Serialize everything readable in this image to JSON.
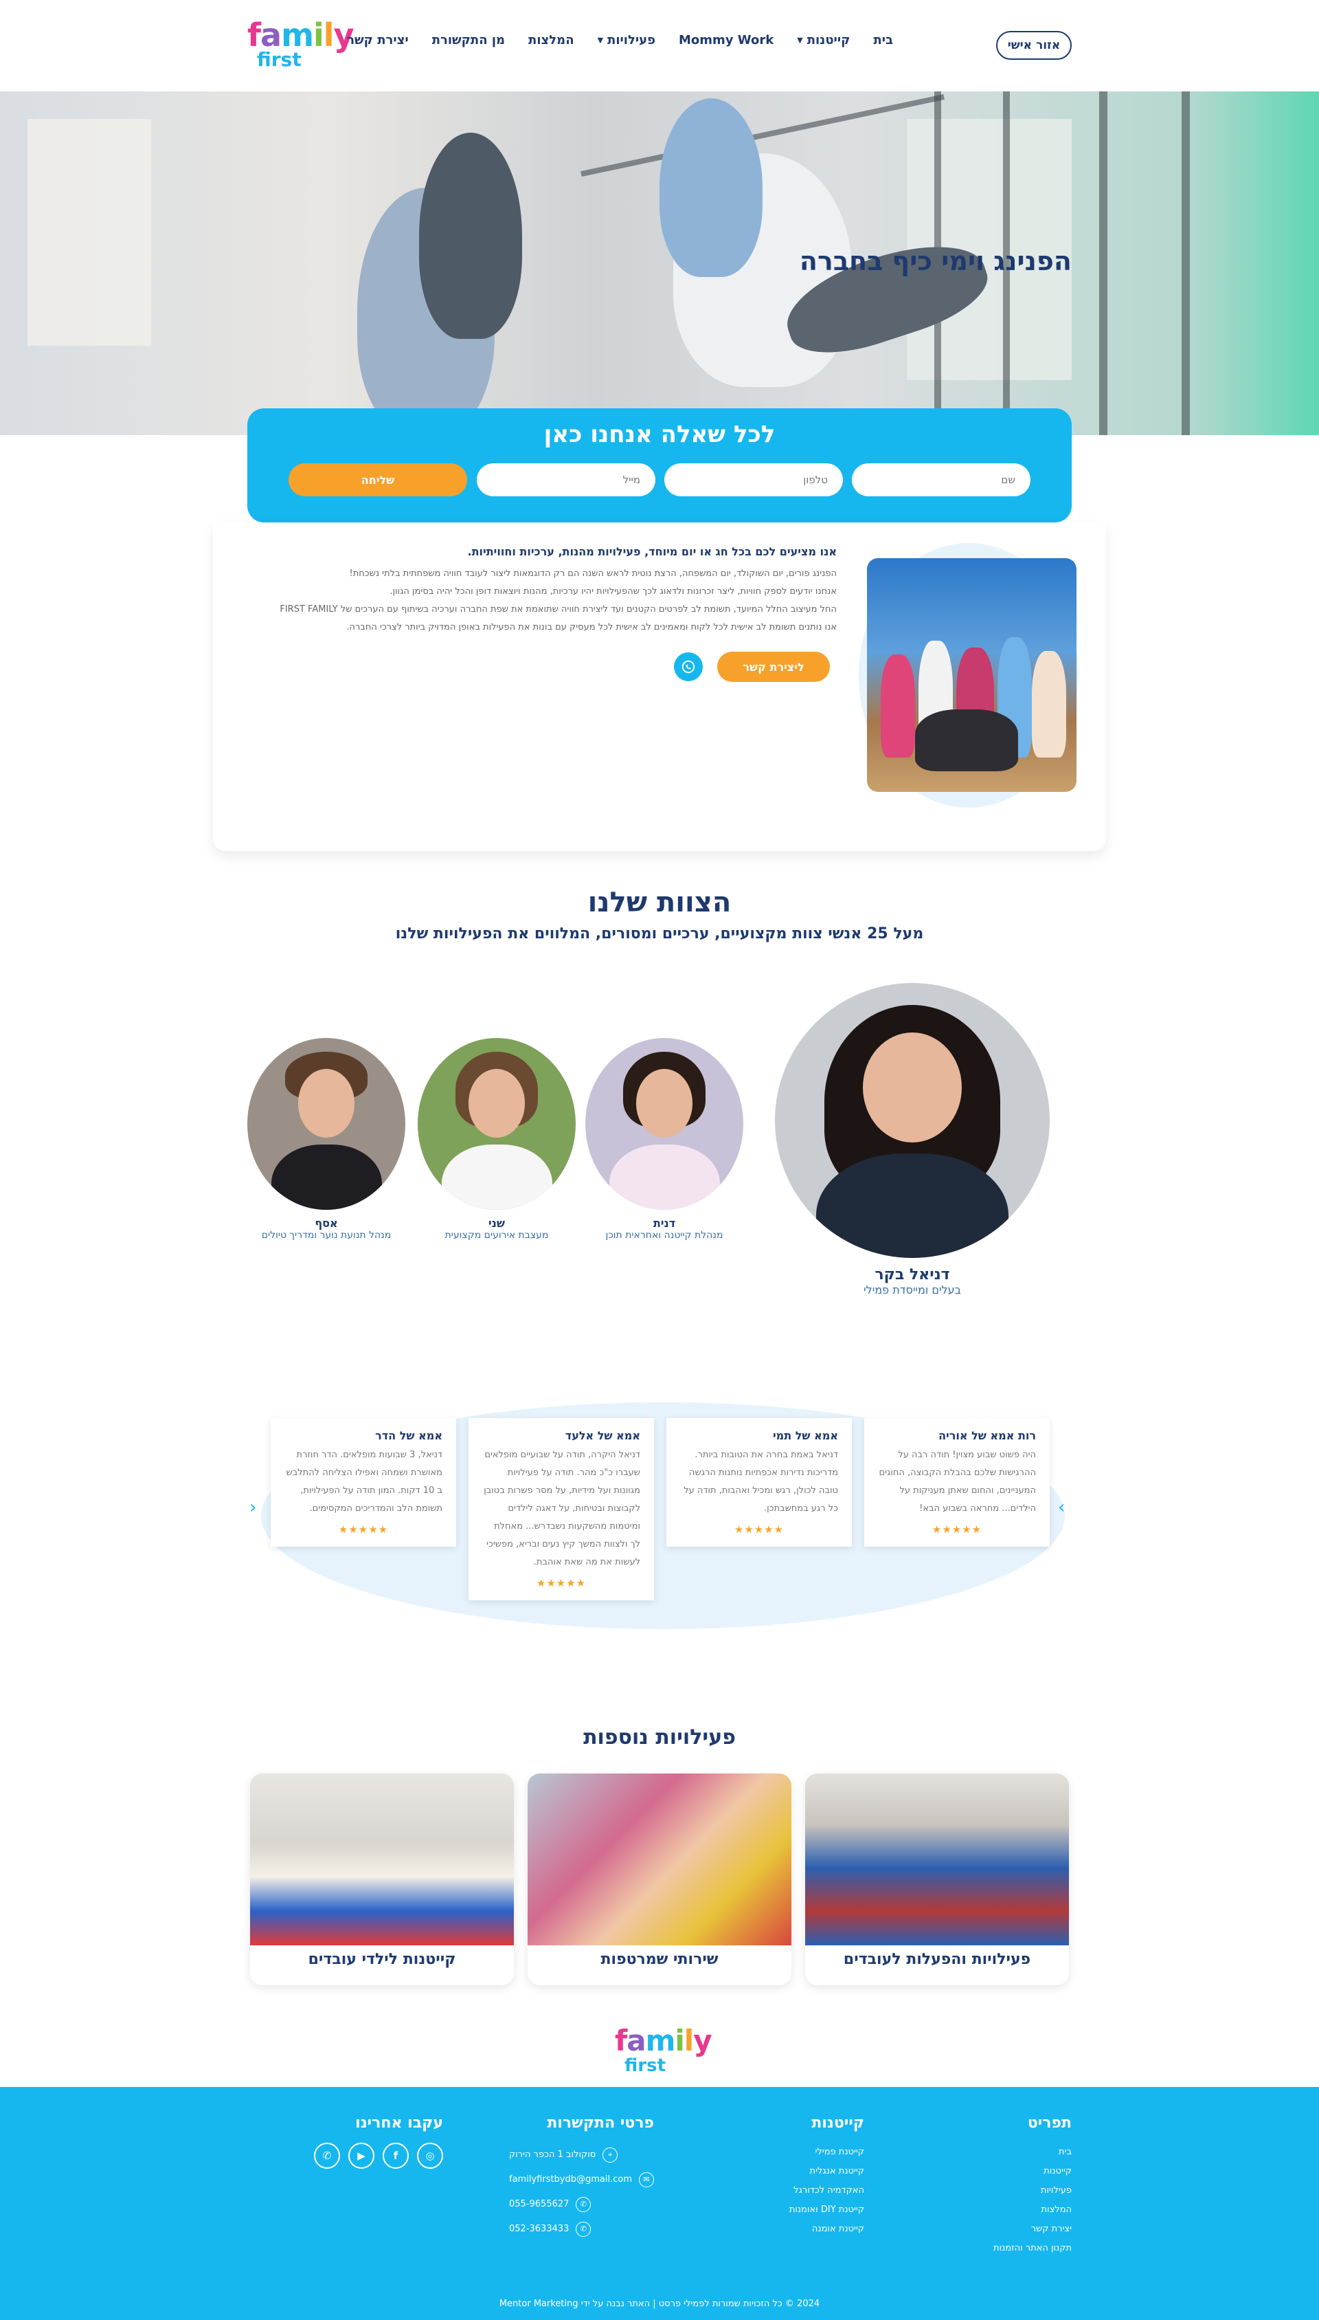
{
  "header": {
    "logo_family": "family",
    "logo_first": "first",
    "nav": [
      {
        "label": "בית",
        "caret": false
      },
      {
        "label": "קייטנות",
        "caret": true
      },
      {
        "label": "Mommy Work",
        "caret": false
      },
      {
        "label": "פעילויות",
        "caret": true
      },
      {
        "label": "המלצות",
        "caret": false
      },
      {
        "label": "מן התקשורת",
        "caret": false
      },
      {
        "label": "יצירת קשר",
        "caret": false
      }
    ],
    "login_label": "אזור אישי"
  },
  "hero": {
    "title": "הפנינג וימי כיף בחברה"
  },
  "form": {
    "title": "לכל שאלה אנחנו כאן",
    "name_placeholder": "שם",
    "phone_placeholder": "טלפון",
    "email_placeholder": "מייל",
    "send_label": "שליחה"
  },
  "about": {
    "lead": "אנו מציעים לכם בכל חג או יום מיוחד, פעילויות מהנות, ערכיות וחוויתיות.",
    "lines": [
      "הפנינג פורים, יום השוקולד, יום המשפחה, הרצת נוטית לראש השנה הם רק הדוגמאות ליצור לעובד חוויה משפחתית בלתי נשכחת!",
      "אנחנו יודעים לספק חוויות, ליצר זכרונות ולדאוג לכך שהפעילויות יהיו ערכיות, מהנות ויוצאות דופן והכל יהיה בסימן הגוון.",
      "החל מעיצוב החלל המיועד, תשומת לב לפרטים הקטנים ועד ליצירת חוויה שתואמת את שפת החברה וערכיה בשיתוף עם הערכים של FIRST FAMILY",
      "אנו נותנים תשומת לב אישית לכל לקוח ומאמינים לב אישית לכל מעסיק עם בונות את הפעילות באופן המדויק ביותר לצרכי החברה."
    ],
    "contact_label": "ליצירת קשר"
  },
  "team": {
    "title": "הצוות שלנו",
    "subtitle": "מעל 25 אנשי צוות מקצועיים, ערכיים ומסורים, המלווים את הפעילויות שלנו",
    "lead": {
      "name": "דניאל בקר",
      "role": "בעלים ומייסדת פמילי"
    },
    "members": [
      {
        "name": "דנית",
        "role": "מנהלת קייטנה ואחראית תוכן"
      },
      {
        "name": "שני",
        "role": "מעצבת אירועים מקצועית"
      },
      {
        "name": "אסף",
        "role": "מנהל תנועת נוער ומדריך טיולים"
      }
    ]
  },
  "testimonials": [
    {
      "name": "רות אמא של אוריה",
      "text": "היה פשוט שבוע מצוין! תודה רבה על ההרגישות שלכם בהבלת הקבוצה, החוגים המעניינים, והחום שאתן מעניקות על הילדים... מחראה בשבוע הבא!",
      "rating": 5
    },
    {
      "name": "אמא של תמי",
      "text": "דניאל באמת בחרה את הטובות ביותר. מדריכות נדירות אכפתיות נותנות הרגשה טובה לכולן, רגש ומכיל ואהבות, תודה על כל רגע במחשבתכן.",
      "rating": 5
    },
    {
      "name": "אמא של אלעד",
      "text": "דניאל היקרה, תודה על שבועיים מופלאים שעברו כ\"כ מהר. תודה על פעילויות מגוונות ועל מידיות, על מסר פשרות בטובן לקבוצות ובטיחות, על דאגה לילדים ומיטמות מהשקעות נשבדרש... מאחלת לך ולצוות המשך קיץ נעים ובריא, מפשיכי לעשות את מה שאת אוהבת.",
      "rating": 5
    },
    {
      "name": "אמא של הדר",
      "text": "דניאל, 3 שבועות מופלאים. הדר חוזרת מאושרת ושמחה ואפילו הצליחה להתלבש ב 10 דקות. המון תודה על הפעילויות, תשומת הלב והמדריכים המקסימים.",
      "rating": 5
    }
  ],
  "more": {
    "title": "פעילויות נוספות",
    "items": [
      {
        "label": "פעילויות והפעלות לעובדים"
      },
      {
        "label": "שירותי שמרטפות"
      },
      {
        "label": "קייטנות לילדי עובדים"
      }
    ]
  },
  "footer": {
    "map_title": "תפריט",
    "map_items": [
      "בית",
      "קייטנות",
      "פעילויות",
      "המלצות",
      "יצירת קשר",
      "תקנון האתר והזמנות"
    ],
    "camps_title": "קייטנות",
    "camps_items": [
      "קייטנת פמילי",
      "קייטנת אנגלית",
      "האקדמיה לכדורגל",
      "קייטנת DIY ואומנות",
      "קייטנת אומנה"
    ],
    "contact_title": "פרטי התקשרות",
    "contact_items": [
      {
        "icon": "location-icon",
        "text": "סוקולוב 1 הכפר הירוק"
      },
      {
        "icon": "mail-icon",
        "text": "familyfirstbydb@gmail.com"
      },
      {
        "icon": "phone-icon",
        "text": "055-9655627"
      },
      {
        "icon": "phone-icon",
        "text": "052-3633433"
      }
    ],
    "follow_title": "עקבו אחרינו",
    "social": [
      "instagram-icon",
      "facebook-icon",
      "youtube-icon",
      "whatsapp-icon"
    ],
    "copyright": "2024 © כל הזכויות שמורות לפמילי פרסט | האתר נבנה על ידי Mentor Marketing"
  },
  "colors": {
    "primary": "#16b7ee",
    "navy": "#1e3a6e",
    "accent": "#f7a12b",
    "logo_pink": "#e8378f",
    "logo_orange": "#f7a12b",
    "logo_green": "#7cc242",
    "logo_purple": "#8b5fbf"
  }
}
